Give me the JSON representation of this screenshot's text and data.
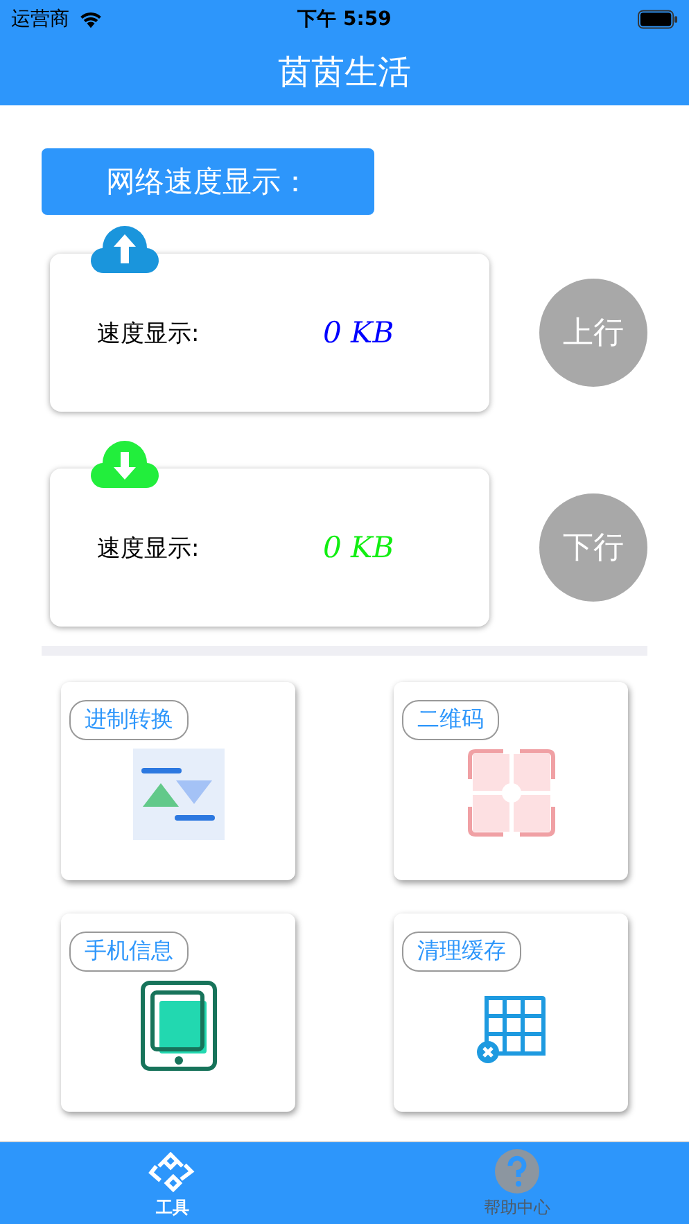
{
  "status_bar": {
    "carrier": "运营商",
    "time": "下午 5:59"
  },
  "nav": {
    "title": "茵茵生活"
  },
  "section": {
    "title": "网络速度显示："
  },
  "speeds": [
    {
      "kind": "up",
      "label": "速度显示:",
      "value": "0 KB",
      "color": "#0000ff",
      "button": "上行"
    },
    {
      "kind": "down",
      "label": "速度显示:",
      "value": "0 KB",
      "color": "#11ee11",
      "button": "下行"
    }
  ],
  "tools": [
    {
      "kind": "convert",
      "label": "进制转换"
    },
    {
      "kind": "qrcode",
      "label": "二维码"
    },
    {
      "kind": "phone",
      "label": "手机信息"
    },
    {
      "kind": "cache",
      "label": "清理缓存"
    }
  ],
  "tabs": [
    {
      "kind": "tools",
      "label": "工具",
      "selected": true
    },
    {
      "kind": "help",
      "label": "帮助中心",
      "selected": false
    }
  ]
}
